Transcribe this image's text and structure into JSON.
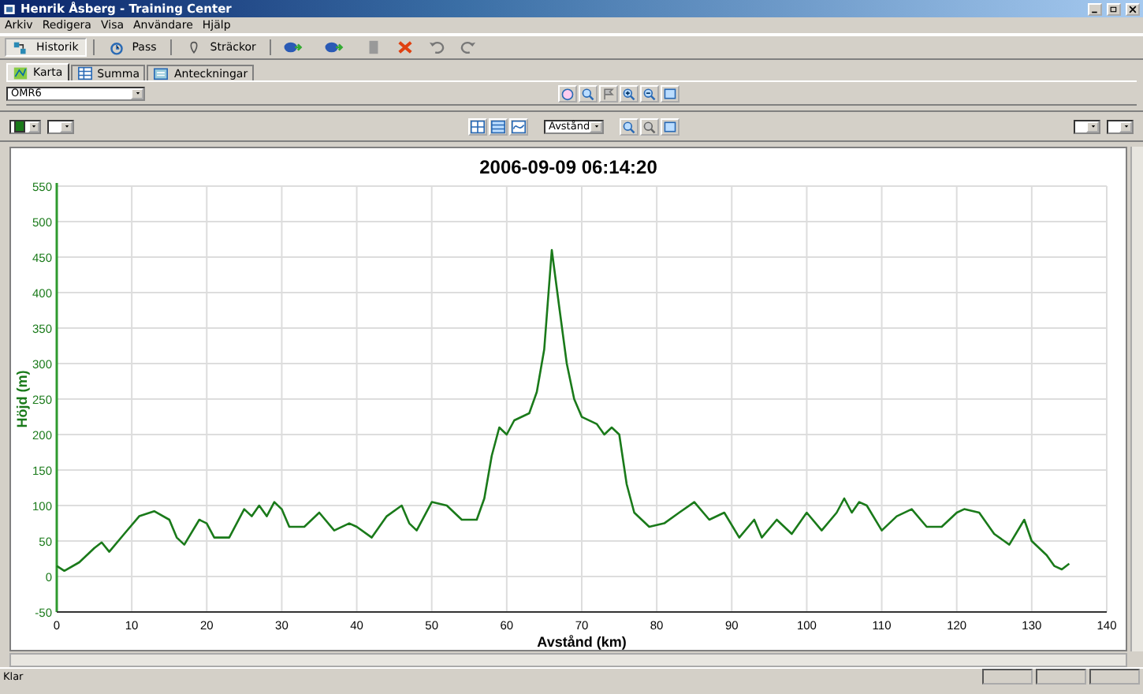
{
  "window": {
    "title": "Henrik Åsberg - Training Center"
  },
  "menu": [
    "Arkiv",
    "Redigera",
    "Visa",
    "Användare",
    "Hjälp"
  ],
  "toolbar": [
    {
      "label": "Historik",
      "selected": true
    },
    {
      "label": "Pass",
      "selected": false
    },
    {
      "label": "Sträckor",
      "selected": false
    }
  ],
  "tabs": [
    {
      "label": "Karta",
      "selected": true
    },
    {
      "label": "Summa",
      "selected": false
    },
    {
      "label": "Anteckningar",
      "selected": false
    }
  ],
  "area_select": {
    "value": "OMR6"
  },
  "chart_toolbar": {
    "x_axis_select": {
      "value": "Avstånd"
    }
  },
  "chart": {
    "chart_data": {
      "type": "line",
      "title": "2006-09-09 06:14:20",
      "xlabel": "Avstånd (km)",
      "ylabel": "Höjd (m)",
      "x": [
        0,
        1,
        3,
        5,
        6,
        7,
        9,
        11,
        13,
        15,
        16,
        17,
        19,
        20,
        21,
        23,
        25,
        26,
        27,
        28,
        29,
        30,
        31,
        33,
        35,
        37,
        39,
        40,
        42,
        44,
        46,
        47,
        48,
        50,
        52,
        54,
        56,
        57,
        58,
        59,
        60,
        61,
        63,
        64,
        65,
        66,
        67,
        68,
        69,
        70,
        72,
        73,
        74,
        75,
        76,
        77,
        79,
        81,
        83,
        85,
        87,
        89,
        91,
        93,
        94,
        96,
        98,
        100,
        102,
        104,
        105,
        106,
        107,
        108,
        110,
        112,
        114,
        116,
        118,
        120,
        121,
        123,
        125,
        127,
        129,
        130,
        132,
        133,
        134,
        135
      ],
      "grid": true,
      "series": [
        {
          "color": "#1a7a1a",
          "values": [
            15,
            8,
            20,
            40,
            48,
            35,
            60,
            85,
            92,
            80,
            55,
            45,
            80,
            75,
            55,
            55,
            95,
            85,
            100,
            85,
            105,
            95,
            70,
            70,
            90,
            65,
            75,
            70,
            55,
            85,
            100,
            75,
            65,
            105,
            100,
            80,
            80,
            110,
            170,
            210,
            200,
            220,
            230,
            260,
            320,
            460,
            380,
            300,
            250,
            225,
            215,
            200,
            210,
            200,
            130,
            90,
            70,
            75,
            90,
            105,
            80,
            90,
            55,
            80,
            55,
            80,
            60,
            90,
            65,
            90,
            110,
            90,
            105,
            100,
            65,
            85,
            95,
            70,
            70,
            90,
            95,
            90,
            60,
            45,
            80,
            50,
            30,
            15,
            10,
            18
          ]
        }
      ],
      "xlim": [
        0,
        140
      ],
      "ylim": [
        -50,
        550
      ],
      "xticks": [
        0,
        10,
        20,
        30,
        40,
        50,
        60,
        70,
        80,
        90,
        100,
        110,
        120,
        130,
        140
      ],
      "yticks": [
        -50,
        0,
        50,
        100,
        150,
        200,
        250,
        300,
        350,
        400,
        450,
        500,
        550
      ]
    }
  },
  "status_bar": {
    "text": "Klar"
  }
}
